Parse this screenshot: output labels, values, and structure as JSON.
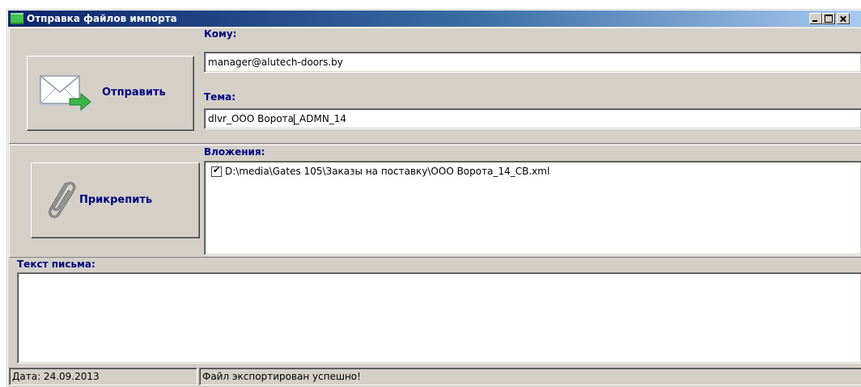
{
  "window": {
    "title": "Отправка файлов импорта"
  },
  "actions": {
    "send_label": "Отправить",
    "attach_label": "Прикрепить"
  },
  "form": {
    "to_label": "Кому:",
    "to_value": "manager@alutech-doors.by",
    "subject_label": "Тема:",
    "subject_before_caret": "dlvr_ООО Ворота",
    "subject_after_caret": "_ADMN_14",
    "attachments_label": "Вложения:",
    "attachments": [
      {
        "checked": true,
        "path": "D:\\media\\Gates 105\\Заказы на поставку\\ООО Ворота_14_СВ.xml"
      }
    ],
    "body_label": "Текст письма:"
  },
  "status": {
    "date": "Дата: 24.09.2013",
    "message": "Файл экспортирован успешно!"
  },
  "colors": {
    "label": "#000080",
    "face": "#d4d0c8",
    "titlebar_start": "#0a246a",
    "titlebar_end": "#a6caf0"
  }
}
